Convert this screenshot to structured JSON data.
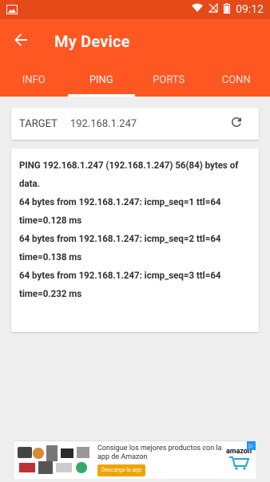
{
  "status_bar": {
    "time": "09:12"
  },
  "app_bar": {
    "title": "My Device"
  },
  "tabs": [
    {
      "label": "INFO",
      "active": false
    },
    {
      "label": "PING",
      "active": true
    },
    {
      "label": "PORTS",
      "active": false
    },
    {
      "label": "CONN",
      "active": false
    }
  ],
  "target": {
    "label": "TARGET",
    "value": "192.168.1.247"
  },
  "ping_output": {
    "lines": [
      "PING 192.168.1.247 (192.168.1.247) 56(84) bytes of data.",
      "64 bytes from 192.168.1.247: icmp_seq=1 ttl=64 time=0.128 ms",
      "64 bytes from 192.168.1.247: icmp_seq=2 ttl=64 time=0.138 ms",
      "64 bytes from 192.168.1.247: icmp_seq=3 ttl=64 time=0.232 ms"
    ]
  },
  "ad": {
    "text": "Consigue los mejores productos con la app de Amazon",
    "cta": "Descarga la app",
    "brand": "amazon"
  },
  "colors": {
    "primary": "#ff5722",
    "primary_dark": "#e64a19"
  }
}
